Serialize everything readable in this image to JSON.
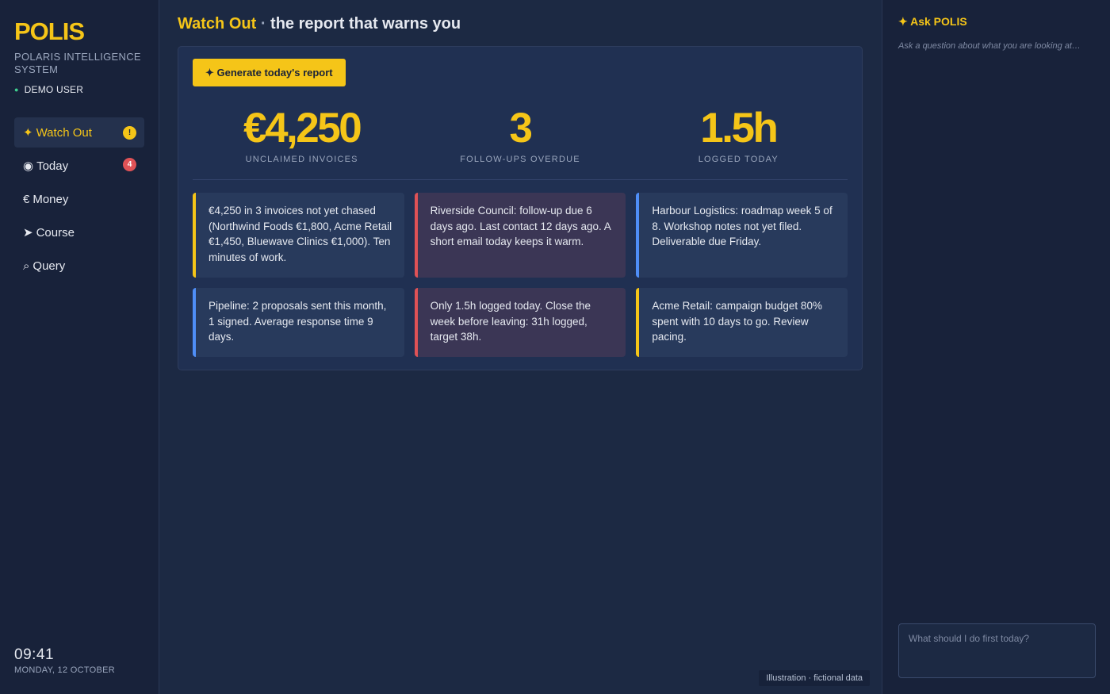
{
  "sidebar": {
    "logo": "POLIS",
    "subtitle": "POLARIS INTELLIGENCE SYSTEM",
    "user": "DEMO USER",
    "items": [
      {
        "icon": "✦",
        "label": "Watch Out",
        "badge": "!"
      },
      {
        "icon": "◉",
        "label": "Today",
        "badge": "4"
      },
      {
        "icon": "€",
        "label": "Money",
        "badge": ""
      },
      {
        "icon": "➤",
        "label": "Course",
        "badge": ""
      },
      {
        "icon": "⌕",
        "label": "Query",
        "badge": ""
      }
    ],
    "time": "09:41",
    "date": "MONDAY, 12 OCTOBER"
  },
  "header": {
    "title": "Watch Out",
    "separator": "·",
    "subtitle": "the report that warns you"
  },
  "report": {
    "generate_label": "✦ Generate today's report",
    "stats": [
      {
        "value": "€4,250",
        "label": "UNCLAIMED INVOICES"
      },
      {
        "value": "3",
        "label": "FOLLOW-UPS OVERDUE"
      },
      {
        "value": "1.5h",
        "label": "LOGGED TODAY"
      }
    ],
    "cards": [
      {
        "text": "€4,250 in 3 invoices not yet chased (Northwind Foods €1,800, Acme Retail €1,450, Bluewave Clinics €1,000). Ten minutes of work.",
        "accent": "yellow"
      },
      {
        "text": "Riverside Council: follow-up due 6 days ago. Last contact 12 days ago. A short email today keeps it warm.",
        "accent": "red"
      },
      {
        "text": "Harbour Logistics: roadmap week 5 of 8. Workshop notes not yet filed. Deliverable due Friday.",
        "accent": "blue"
      },
      {
        "text": "Pipeline: 2 proposals sent this month, 1 signed. Average response time 9 days.",
        "accent": "blue"
      },
      {
        "text": "Only 1.5h logged today. Close the week before leaving: 31h logged, target 38h.",
        "accent": "red"
      },
      {
        "text": "Acme Retail: campaign budget 80% spent with 10 days to go. Review pacing.",
        "accent": "yellow"
      }
    ]
  },
  "footnote": "Illustration · fictional data",
  "ask": {
    "title": "✦ Ask POLIS",
    "hint": "Ask a question about what you are looking at…",
    "placeholder": "What should I do first today?",
    "value": ""
  },
  "colors": {
    "accent": "#f5c518",
    "alert_red": "#e05256",
    "info_blue": "#4f8ef7",
    "status_green": "#3fd08f"
  }
}
